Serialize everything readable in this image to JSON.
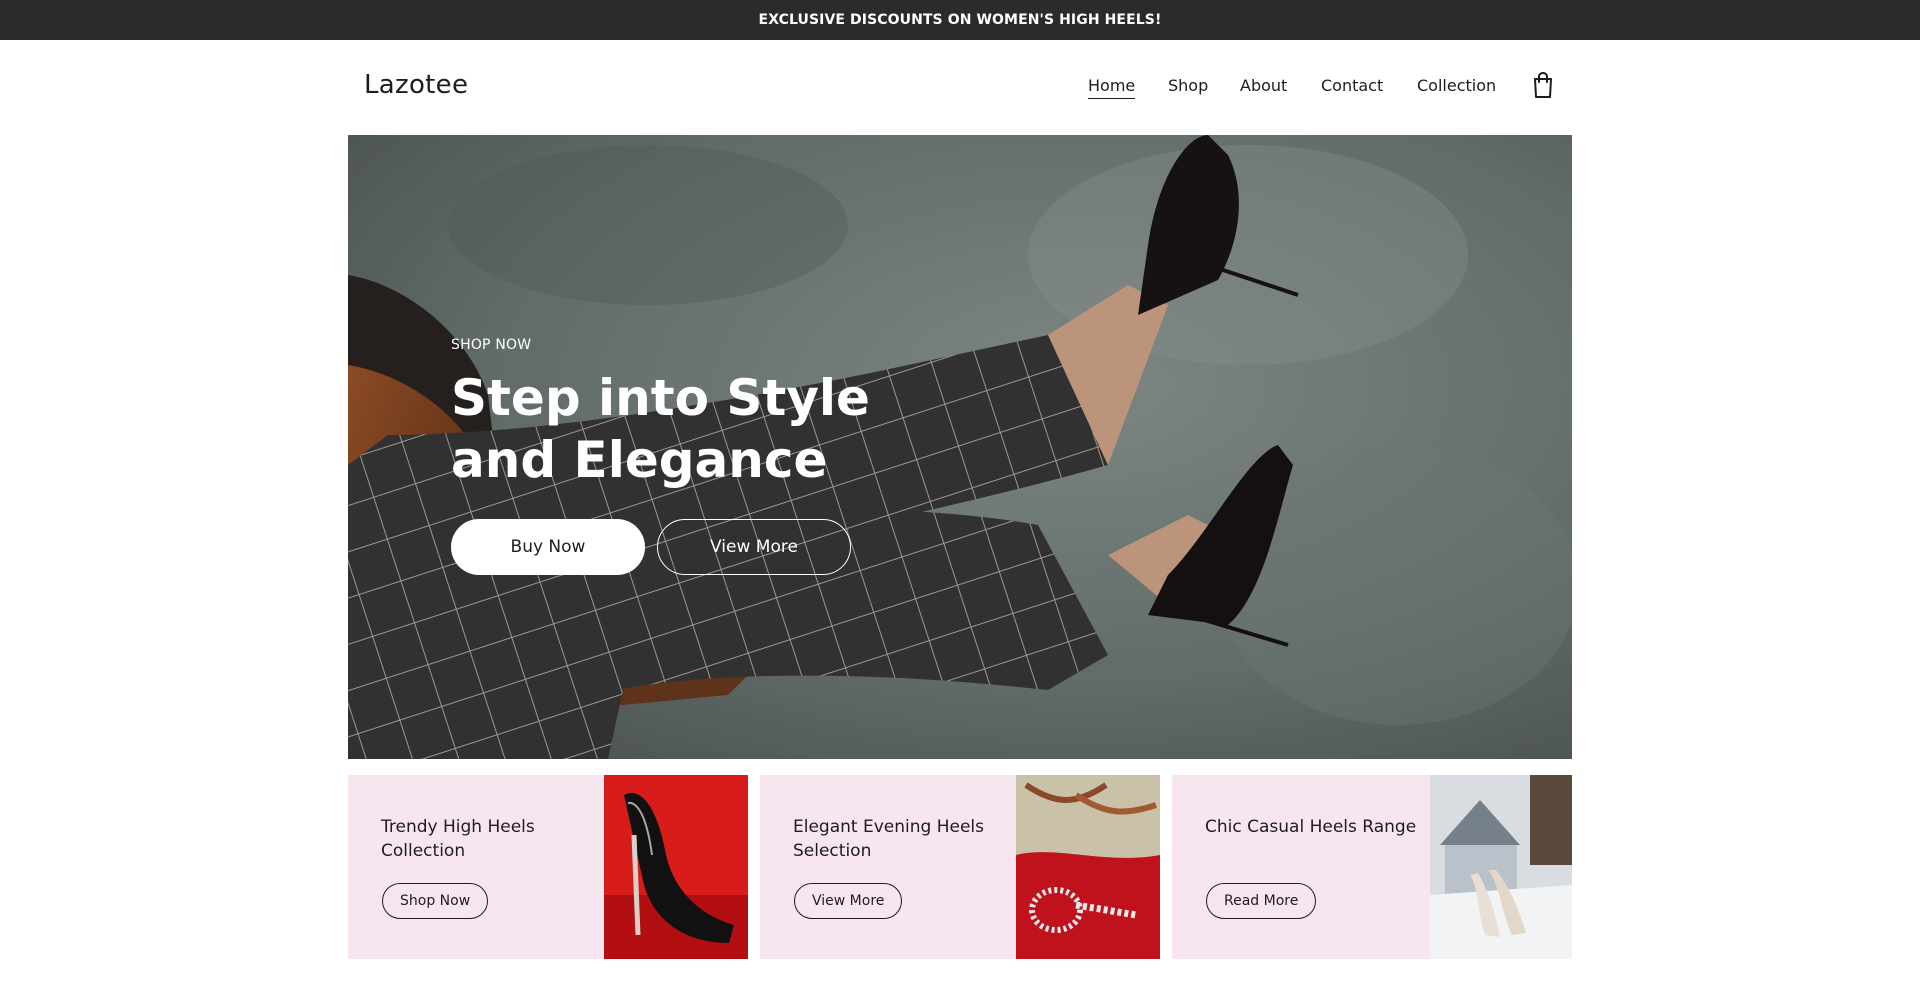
{
  "announcement": "EXCLUSIVE DISCOUNTS ON WOMEN'S HIGH HEELS!",
  "brand": "Lazotee",
  "nav": {
    "items": [
      {
        "label": "Home",
        "active": true
      },
      {
        "label": "Shop",
        "active": false
      },
      {
        "label": "About",
        "active": false
      },
      {
        "label": "Contact",
        "active": false
      },
      {
        "label": "Collection",
        "active": false
      }
    ],
    "cart_icon": "shopping-bag-icon"
  },
  "hero": {
    "kicker": "SHOP NOW",
    "headline": "Step into Style and Elegance",
    "primary_button": "Buy Now",
    "secondary_button": "View More"
  },
  "promos": [
    {
      "title": "Trendy High Heels Collection",
      "button": "Shop Now"
    },
    {
      "title": "Elegant Evening Heels Selection",
      "button": "View More"
    },
    {
      "title": "Chic Casual Heels Range",
      "button": "Read More"
    }
  ],
  "colors": {
    "announcement_bg": "#2b2b2d",
    "promo_bg": "#f7e6f0",
    "text": "#1d1d1d"
  }
}
